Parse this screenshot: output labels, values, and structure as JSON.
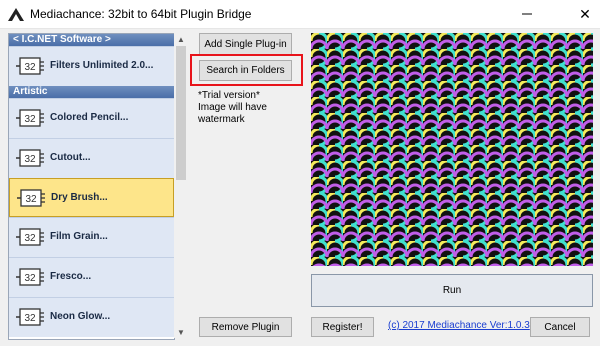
{
  "window": {
    "title": "Mediachance: 32bit to 64bit Plugin Bridge",
    "close_glyph": "✕"
  },
  "list": {
    "groups": [
      {
        "header": "< I.C.NET Software >",
        "items": [
          {
            "label": "Filters Unlimited 2.0...",
            "chip": "32"
          }
        ]
      },
      {
        "header": "Artistic",
        "items": [
          {
            "label": "Colored Pencil...",
            "chip": "32"
          },
          {
            "label": "Cutout...",
            "chip": "32"
          },
          {
            "label": "Dry Brush...",
            "chip": "32",
            "selected": true
          },
          {
            "label": "Film Grain...",
            "chip": "32"
          },
          {
            "label": "Fresco...",
            "chip": "32"
          },
          {
            "label": "Neon Glow...",
            "chip": "32"
          }
        ]
      }
    ]
  },
  "buttons": {
    "add_single": "Add Single Plug-in",
    "search_folders": "Search in Folders",
    "remove": "Remove Plugin",
    "register": "Register!",
    "cancel": "Cancel",
    "run": "Run"
  },
  "trial_note": "*Trial version*\nImage will have\nwatermark",
  "footer_link": "(c) 2017 Mediachance Ver:1.0.3",
  "colors": {
    "highlight": "#e8141b",
    "pattern": [
      "#f4ea5a",
      "#3fe0d0",
      "#c05ee8",
      "#2f57ff"
    ]
  }
}
